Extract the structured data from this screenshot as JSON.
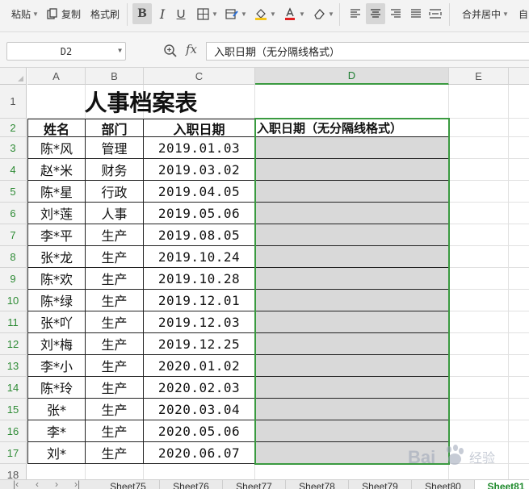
{
  "toolbar": {
    "paste": "粘贴",
    "copy": "复制",
    "format_painter": "格式刷",
    "merge_center": "合并居中",
    "auto_wrap": "自"
  },
  "formula_bar": {
    "cell_ref": "D2",
    "fx": "fx",
    "formula": "入职日期（无分隔线格式）"
  },
  "columns": [
    "A",
    "B",
    "C",
    "D",
    "E"
  ],
  "rows": [
    "1",
    "2",
    "3",
    "4",
    "5",
    "6",
    "7",
    "8",
    "9",
    "10",
    "11",
    "12",
    "13",
    "14",
    "15",
    "16",
    "17",
    "18"
  ],
  "sheet": {
    "title": "人事档案表",
    "headers": [
      "姓名",
      "部门",
      "入职日期",
      "入职日期（无分隔线格式）"
    ],
    "records": [
      {
        "name": "陈*风",
        "dept": "管理",
        "date": "2019.01.03"
      },
      {
        "name": "赵*米",
        "dept": "财务",
        "date": "2019.03.02"
      },
      {
        "name": "陈*星",
        "dept": "行政",
        "date": "2019.04.05"
      },
      {
        "name": "刘*莲",
        "dept": "人事",
        "date": "2019.05.06"
      },
      {
        "name": "李*平",
        "dept": "生产",
        "date": "2019.08.05"
      },
      {
        "name": "张*龙",
        "dept": "生产",
        "date": "2019.10.24"
      },
      {
        "name": "陈*欢",
        "dept": "生产",
        "date": "2019.10.28"
      },
      {
        "name": "陈*绿",
        "dept": "生产",
        "date": "2019.12.01"
      },
      {
        "name": "张*吖",
        "dept": "生产",
        "date": "2019.12.03"
      },
      {
        "name": "刘*梅",
        "dept": "生产",
        "date": "2019.12.25"
      },
      {
        "name": "李*小",
        "dept": "生产",
        "date": "2020.01.02"
      },
      {
        "name": "陈*玲",
        "dept": "生产",
        "date": "2020.02.03"
      },
      {
        "name": "张*",
        "dept": "生产",
        "date": "2020.03.04"
      },
      {
        "name": "李*",
        "dept": "生产",
        "date": "2020.05.06"
      },
      {
        "name": "刘*",
        "dept": "生产",
        "date": "2020.06.07"
      }
    ]
  },
  "sheet_tabs": [
    "Sheet75",
    "Sheet76",
    "Sheet77",
    "Sheet78",
    "Sheet79",
    "Sheet80",
    "Sheet81"
  ],
  "active_tab": "Sheet81",
  "watermark_text": "Bai 经验",
  "colors": {
    "selection_green": "#3a9a40",
    "selected_fill": "#d9d9d9",
    "active_tab_text": "#1e8a2c"
  }
}
